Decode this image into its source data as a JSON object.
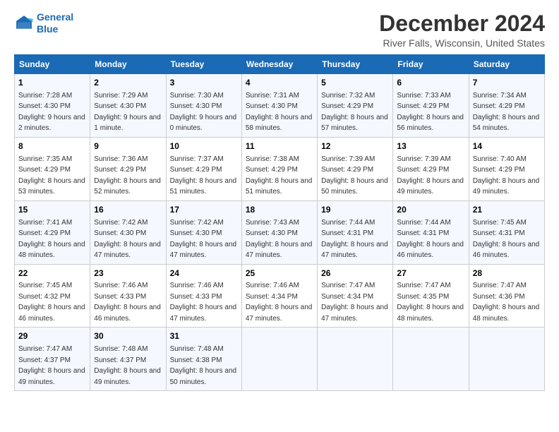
{
  "logo": {
    "line1": "General",
    "line2": "Blue"
  },
  "title": "December 2024",
  "subtitle": "River Falls, Wisconsin, United States",
  "columns": [
    "Sunday",
    "Monday",
    "Tuesday",
    "Wednesday",
    "Thursday",
    "Friday",
    "Saturday"
  ],
  "weeks": [
    [
      {
        "day": "1",
        "rise": "Sunrise: 7:28 AM",
        "set": "Sunset: 4:30 PM",
        "daylight": "Daylight: 9 hours and 2 minutes."
      },
      {
        "day": "2",
        "rise": "Sunrise: 7:29 AM",
        "set": "Sunset: 4:30 PM",
        "daylight": "Daylight: 9 hours and 1 minute."
      },
      {
        "day": "3",
        "rise": "Sunrise: 7:30 AM",
        "set": "Sunset: 4:30 PM",
        "daylight": "Daylight: 9 hours and 0 minutes."
      },
      {
        "day": "4",
        "rise": "Sunrise: 7:31 AM",
        "set": "Sunset: 4:30 PM",
        "daylight": "Daylight: 8 hours and 58 minutes."
      },
      {
        "day": "5",
        "rise": "Sunrise: 7:32 AM",
        "set": "Sunset: 4:29 PM",
        "daylight": "Daylight: 8 hours and 57 minutes."
      },
      {
        "day": "6",
        "rise": "Sunrise: 7:33 AM",
        "set": "Sunset: 4:29 PM",
        "daylight": "Daylight: 8 hours and 56 minutes."
      },
      {
        "day": "7",
        "rise": "Sunrise: 7:34 AM",
        "set": "Sunset: 4:29 PM",
        "daylight": "Daylight: 8 hours and 54 minutes."
      }
    ],
    [
      {
        "day": "8",
        "rise": "Sunrise: 7:35 AM",
        "set": "Sunset: 4:29 PM",
        "daylight": "Daylight: 8 hours and 53 minutes."
      },
      {
        "day": "9",
        "rise": "Sunrise: 7:36 AM",
        "set": "Sunset: 4:29 PM",
        "daylight": "Daylight: 8 hours and 52 minutes."
      },
      {
        "day": "10",
        "rise": "Sunrise: 7:37 AM",
        "set": "Sunset: 4:29 PM",
        "daylight": "Daylight: 8 hours and 51 minutes."
      },
      {
        "day": "11",
        "rise": "Sunrise: 7:38 AM",
        "set": "Sunset: 4:29 PM",
        "daylight": "Daylight: 8 hours and 51 minutes."
      },
      {
        "day": "12",
        "rise": "Sunrise: 7:39 AM",
        "set": "Sunset: 4:29 PM",
        "daylight": "Daylight: 8 hours and 50 minutes."
      },
      {
        "day": "13",
        "rise": "Sunrise: 7:39 AM",
        "set": "Sunset: 4:29 PM",
        "daylight": "Daylight: 8 hours and 49 minutes."
      },
      {
        "day": "14",
        "rise": "Sunrise: 7:40 AM",
        "set": "Sunset: 4:29 PM",
        "daylight": "Daylight: 8 hours and 49 minutes."
      }
    ],
    [
      {
        "day": "15",
        "rise": "Sunrise: 7:41 AM",
        "set": "Sunset: 4:29 PM",
        "daylight": "Daylight: 8 hours and 48 minutes."
      },
      {
        "day": "16",
        "rise": "Sunrise: 7:42 AM",
        "set": "Sunset: 4:30 PM",
        "daylight": "Daylight: 8 hours and 47 minutes."
      },
      {
        "day": "17",
        "rise": "Sunrise: 7:42 AM",
        "set": "Sunset: 4:30 PM",
        "daylight": "Daylight: 8 hours and 47 minutes."
      },
      {
        "day": "18",
        "rise": "Sunrise: 7:43 AM",
        "set": "Sunset: 4:30 PM",
        "daylight": "Daylight: 8 hours and 47 minutes."
      },
      {
        "day": "19",
        "rise": "Sunrise: 7:44 AM",
        "set": "Sunset: 4:31 PM",
        "daylight": "Daylight: 8 hours and 47 minutes."
      },
      {
        "day": "20",
        "rise": "Sunrise: 7:44 AM",
        "set": "Sunset: 4:31 PM",
        "daylight": "Daylight: 8 hours and 46 minutes."
      },
      {
        "day": "21",
        "rise": "Sunrise: 7:45 AM",
        "set": "Sunset: 4:31 PM",
        "daylight": "Daylight: 8 hours and 46 minutes."
      }
    ],
    [
      {
        "day": "22",
        "rise": "Sunrise: 7:45 AM",
        "set": "Sunset: 4:32 PM",
        "daylight": "Daylight: 8 hours and 46 minutes."
      },
      {
        "day": "23",
        "rise": "Sunrise: 7:46 AM",
        "set": "Sunset: 4:33 PM",
        "daylight": "Daylight: 8 hours and 46 minutes."
      },
      {
        "day": "24",
        "rise": "Sunrise: 7:46 AM",
        "set": "Sunset: 4:33 PM",
        "daylight": "Daylight: 8 hours and 47 minutes."
      },
      {
        "day": "25",
        "rise": "Sunrise: 7:46 AM",
        "set": "Sunset: 4:34 PM",
        "daylight": "Daylight: 8 hours and 47 minutes."
      },
      {
        "day": "26",
        "rise": "Sunrise: 7:47 AM",
        "set": "Sunset: 4:34 PM",
        "daylight": "Daylight: 8 hours and 47 minutes."
      },
      {
        "day": "27",
        "rise": "Sunrise: 7:47 AM",
        "set": "Sunset: 4:35 PM",
        "daylight": "Daylight: 8 hours and 48 minutes."
      },
      {
        "day": "28",
        "rise": "Sunrise: 7:47 AM",
        "set": "Sunset: 4:36 PM",
        "daylight": "Daylight: 8 hours and 48 minutes."
      }
    ],
    [
      {
        "day": "29",
        "rise": "Sunrise: 7:47 AM",
        "set": "Sunset: 4:37 PM",
        "daylight": "Daylight: 8 hours and 49 minutes."
      },
      {
        "day": "30",
        "rise": "Sunrise: 7:48 AM",
        "set": "Sunset: 4:37 PM",
        "daylight": "Daylight: 8 hours and 49 minutes."
      },
      {
        "day": "31",
        "rise": "Sunrise: 7:48 AM",
        "set": "Sunset: 4:38 PM",
        "daylight": "Daylight: 8 hours and 50 minutes."
      },
      null,
      null,
      null,
      null
    ]
  ]
}
